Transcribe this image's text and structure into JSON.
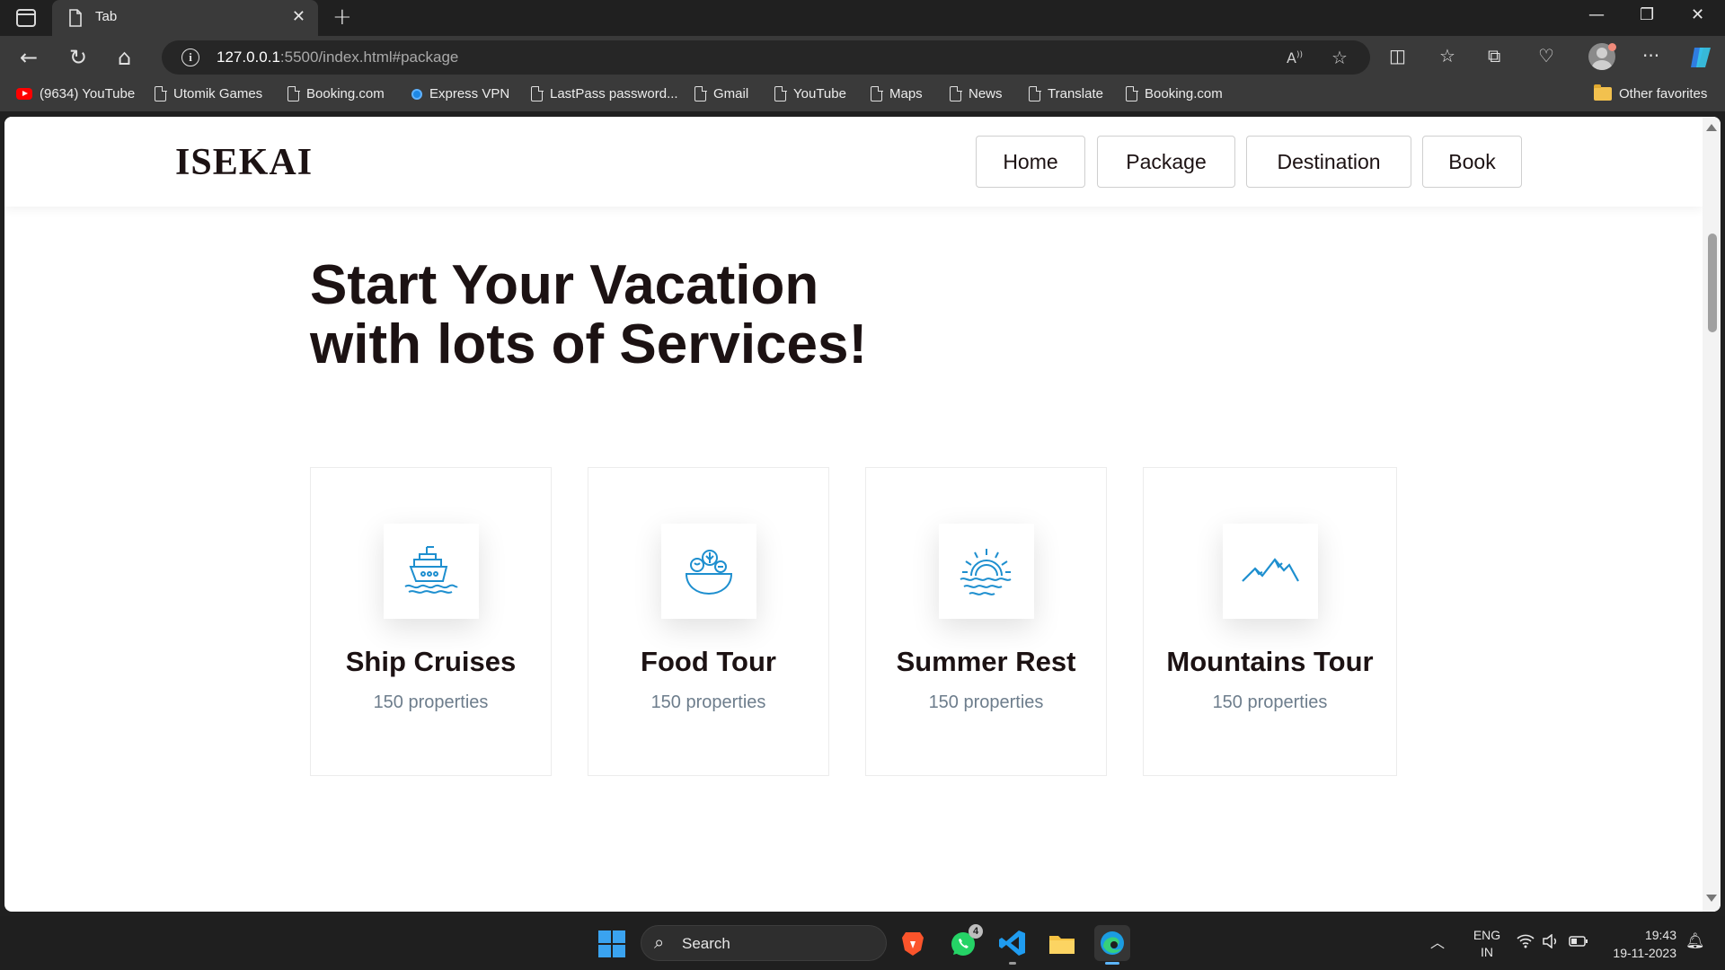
{
  "browser": {
    "tab_title": "Tab",
    "url_host": "127.0.0.1",
    "url_rest": ":5500/index.html#package"
  },
  "bookmarks": [
    {
      "label": "(9634) YouTube",
      "icon": "youtube-icon"
    },
    {
      "label": "Utomik Games",
      "icon": "page-icon"
    },
    {
      "label": "Booking.com",
      "icon": "page-icon"
    },
    {
      "label": "Express VPN",
      "icon": "vpn-icon"
    },
    {
      "label": "LastPass password...",
      "icon": "page-icon"
    },
    {
      "label": "Gmail",
      "icon": "page-icon"
    },
    {
      "label": "YouTube",
      "icon": "page-icon"
    },
    {
      "label": "Maps",
      "icon": "page-icon"
    },
    {
      "label": "News",
      "icon": "page-icon"
    },
    {
      "label": "Translate",
      "icon": "page-icon"
    },
    {
      "label": "Booking.com",
      "icon": "page-icon"
    }
  ],
  "other_favorites": "Other favorites",
  "site": {
    "logo": "ISEKAI",
    "nav": [
      "Home",
      "Package",
      "Destination",
      "Book"
    ],
    "heading_line1": "Start Your Vacation",
    "heading_line2": "with lots of Services!",
    "accent_color": "#2a9fd6",
    "services": [
      {
        "title": "Ship Cruises",
        "subtitle": "150 properties",
        "icon": "ship-icon"
      },
      {
        "title": "Food Tour",
        "subtitle": "150 properties",
        "icon": "food-bowl-icon"
      },
      {
        "title": "Summer Rest",
        "subtitle": "150 properties",
        "icon": "sun-waves-icon"
      },
      {
        "title": "Mountains Tour",
        "subtitle": "150 properties",
        "icon": "mountains-icon"
      }
    ]
  },
  "taskbar": {
    "search_label": "Search",
    "whatsapp_badge": "4",
    "lang_line1": "ENG",
    "lang_line2": "IN",
    "time": "19:43",
    "date": "19-11-2023"
  }
}
